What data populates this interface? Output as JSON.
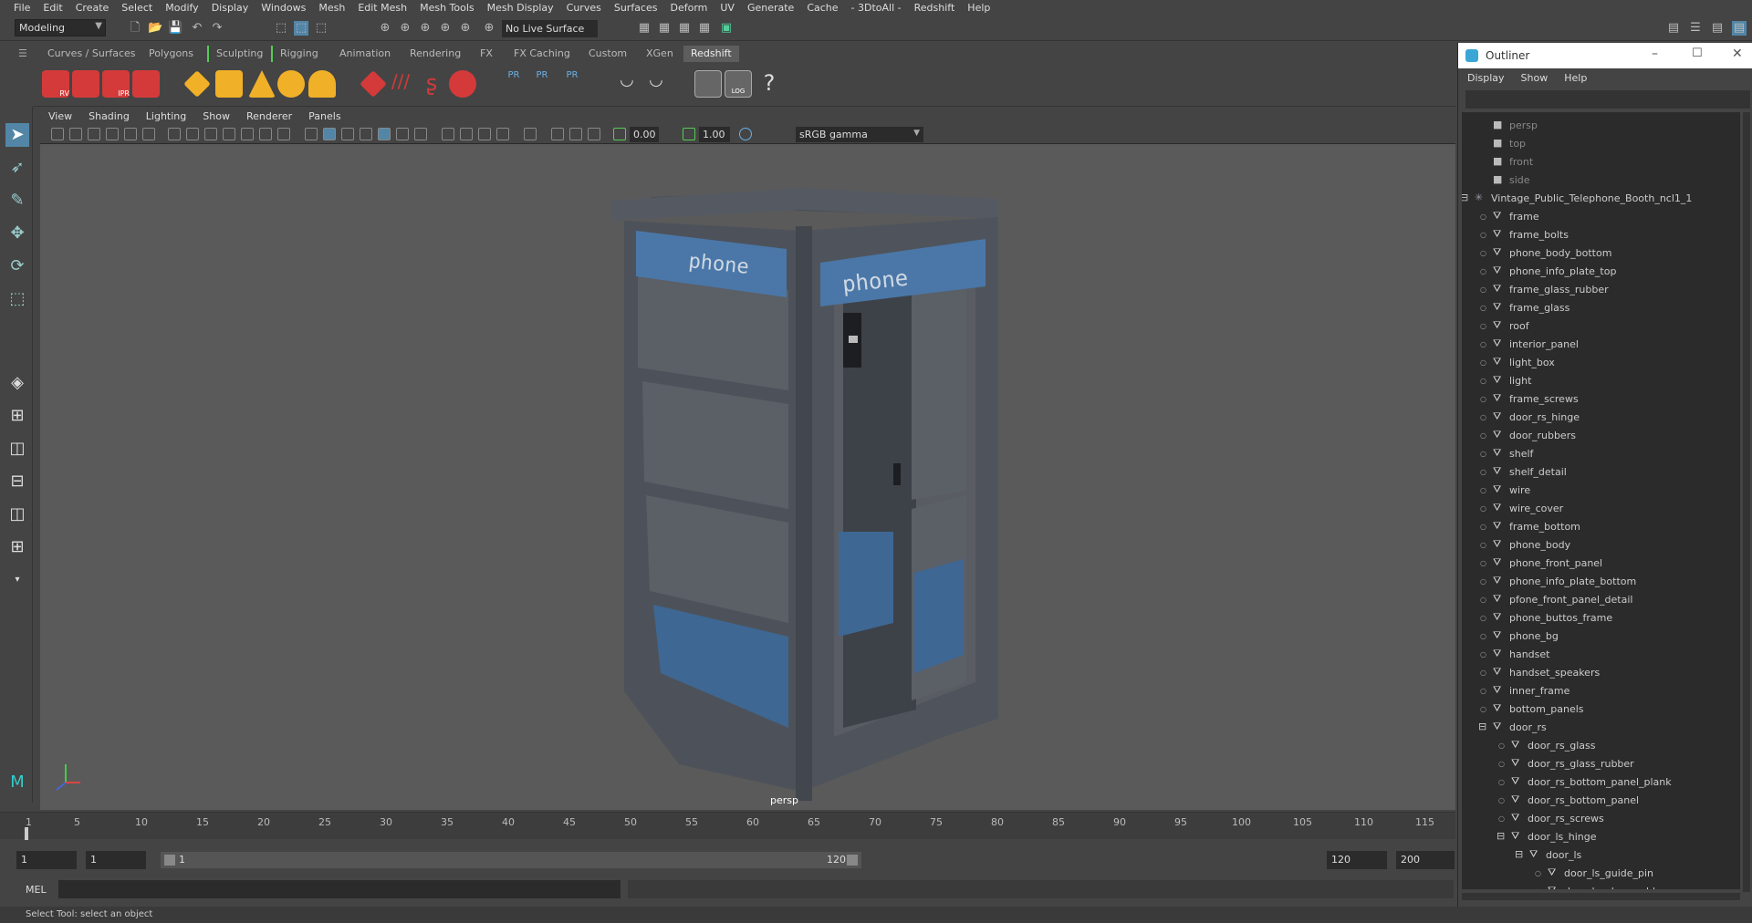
{
  "menubar": [
    "File",
    "Edit",
    "Create",
    "Select",
    "Modify",
    "Display",
    "Windows",
    "Mesh",
    "Edit Mesh",
    "Mesh Tools",
    "Mesh Display",
    "Curves",
    "Surfaces",
    "Deform",
    "UV",
    "Generate",
    "Cache",
    "- 3DtoAll -",
    "Redshift",
    "Help"
  ],
  "status": {
    "mode": "Modeling",
    "live_surface": "No Live Surface"
  },
  "shelf_tabs": [
    "Curves / Surfaces",
    "Polygons",
    "Sculpting",
    "Rigging",
    "Animation",
    "Rendering",
    "FX",
    "FX Caching",
    "Custom",
    "XGen",
    "Redshift"
  ],
  "shelf_active": "Redshift",
  "shelf_icons": [
    "RV",
    "IPR",
    "PR",
    "PR",
    "PR",
    "LOG",
    "?"
  ],
  "viewport_menu": [
    "View",
    "Shading",
    "Lighting",
    "Show",
    "Renderer",
    "Panels"
  ],
  "viewport_toolbar": {
    "exposure": "0.00",
    "gamma": "1.00",
    "color_space": "sRGB gamma"
  },
  "viewport": {
    "camera_label": "persp",
    "sign_text": "phone"
  },
  "timeline": {
    "ticks": [
      "1",
      "5",
      "10",
      "15",
      "20",
      "25",
      "30",
      "35",
      "40",
      "45",
      "50",
      "55",
      "60",
      "65",
      "70",
      "75",
      "80",
      "85",
      "90",
      "95",
      "100",
      "105",
      "110",
      "115"
    ]
  },
  "range": {
    "start": "1",
    "anim_start": "1",
    "slider_start": "1",
    "slider_end": "120",
    "anim_end": "120",
    "end": "200"
  },
  "cmdline": {
    "label": "MEL"
  },
  "help_line": "Select Tool: select an object",
  "outliner": {
    "title": "Outliner",
    "menu": [
      "Display",
      "Show",
      "Help"
    ],
    "cameras": [
      "persp",
      "top",
      "front",
      "side"
    ],
    "root": "Vintage_Public_Telephone_Booth_ncl1_1",
    "children": [
      "frame",
      "frame_bolts",
      "phone_body_bottom",
      "phone_info_plate_top",
      "frame_glass_rubber",
      "frame_glass",
      "roof",
      "interior_panel",
      "light_box",
      "light",
      "frame_screws",
      "door_rs_hinge",
      "door_rubbers",
      "shelf",
      "shelf_detail",
      "wire",
      "wire_cover",
      "frame_bottom",
      "phone_body",
      "phone_front_panel",
      "phone_info_plate_bottom",
      "pfone_front_panel_detail",
      "phone_buttos_frame",
      "phone_bg",
      "handset",
      "handset_speakers",
      "inner_frame",
      "bottom_panels",
      "door_rs"
    ],
    "door_rs_children": [
      "door_rs_glass",
      "door_rs_glass_rubber",
      "door_rs_bottom_panel_plank",
      "door_rs_bottom_panel",
      "door_rs_screws",
      "door_ls_hinge"
    ],
    "door_ls_hinge_children": [
      "door_ls"
    ],
    "door_ls_children": [
      "door_ls_guide_pin",
      "door_ls_glass_rubber"
    ]
  }
}
